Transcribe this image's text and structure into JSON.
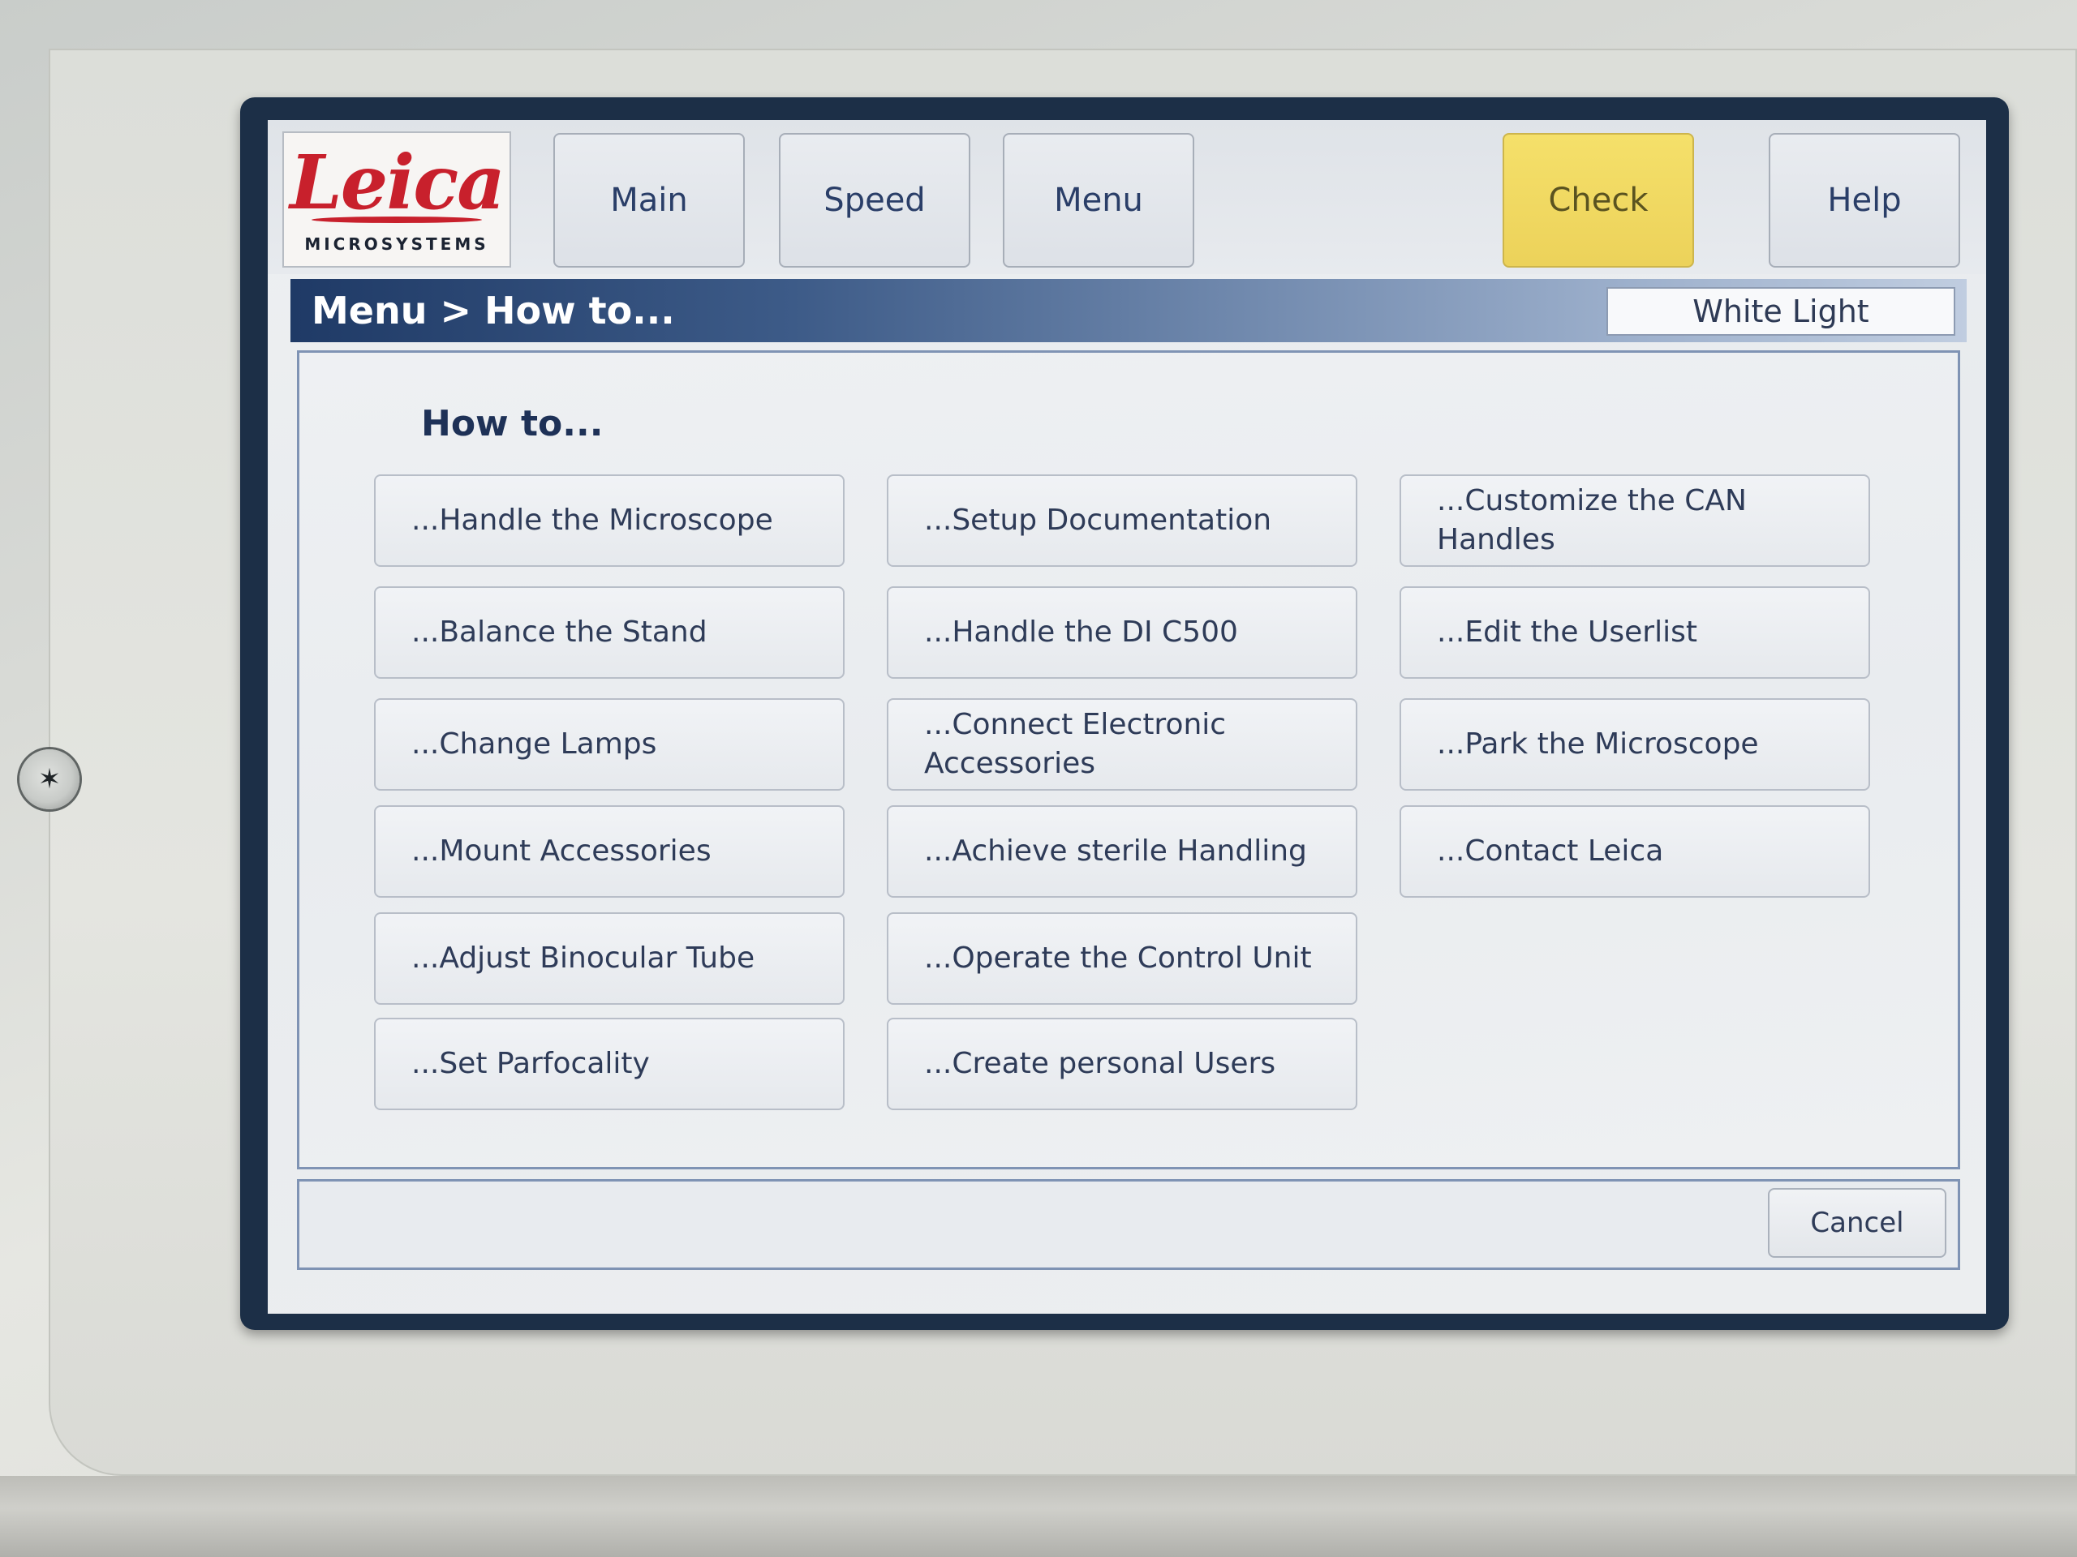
{
  "logo": {
    "script": "Leica",
    "subtitle": "MICROSYSTEMS"
  },
  "toolbar": {
    "main_label": "Main",
    "speed_label": "Speed",
    "menu_label": "Menu",
    "check_label": "Check",
    "help_label": "Help",
    "check_color": "#ecd25a"
  },
  "breadcrumb": {
    "text": "Menu > How to..."
  },
  "mode": {
    "value": "White Light"
  },
  "page": {
    "title": "How to..."
  },
  "items": [
    {
      "label": "...Handle the Microscope"
    },
    {
      "label": "...Balance the Stand"
    },
    {
      "label": "...Change Lamps"
    },
    {
      "label": "...Mount Accessories"
    },
    {
      "label": "...Adjust Binocular Tube"
    },
    {
      "label": "...Set Parfocality"
    },
    {
      "label": "...Setup Documentation"
    },
    {
      "label": "...Handle the DI C500"
    },
    {
      "label": "...Connect Electronic Accessories"
    },
    {
      "label": "...Achieve sterile Handling"
    },
    {
      "label": "...Operate the Control Unit"
    },
    {
      "label": "...Create personal Users"
    },
    {
      "label": "...Customize the CAN Handles"
    },
    {
      "label": "...Edit the Userlist"
    },
    {
      "label": "...Park the Microscope"
    },
    {
      "label": "...Contact Leica"
    }
  ],
  "footer": {
    "cancel_label": "Cancel"
  },
  "colors": {
    "title_bar_dark": "#1f3a66",
    "text": "#2e3b58"
  },
  "icons": {
    "bezel_screw": "screw-icon"
  }
}
